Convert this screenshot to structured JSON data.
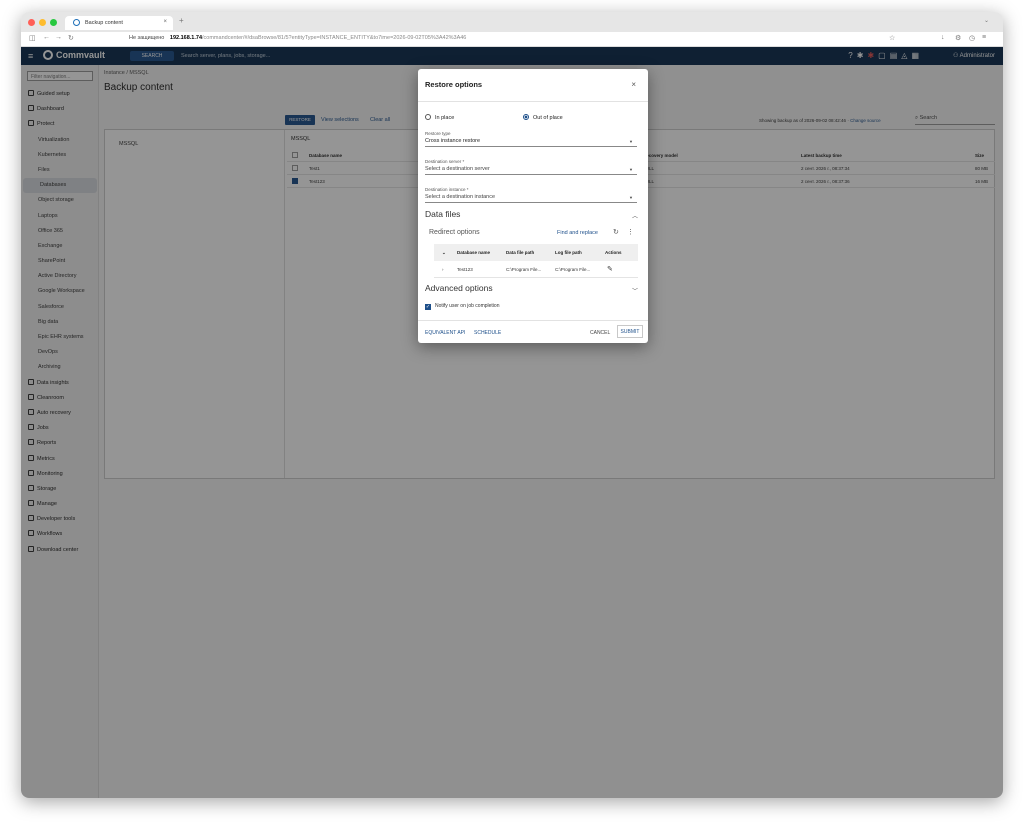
{
  "browser": {
    "tab_title": "Backup content",
    "security_label": "Не защищено",
    "url_host": "192.168.1.74",
    "url_path": "/commandcenter/#/dsaBrowse/81/5?entityType=INSTANCE_ENTITY&to7ime=2026-09-02T05%3A42%3A46"
  },
  "app": {
    "brand": "Commvault",
    "search_button": "SEARCH",
    "search_placeholder": "Search server, plans, jobs, storage...",
    "user": "Administrator"
  },
  "sidebar": {
    "filter_placeholder": "Filter navigation...",
    "items": [
      {
        "label": "Guided setup",
        "type": "top"
      },
      {
        "label": "Dashboard",
        "type": "top"
      },
      {
        "label": "Protect",
        "type": "top"
      },
      {
        "label": "Virtualization",
        "type": "child"
      },
      {
        "label": "Kubernetes",
        "type": "child"
      },
      {
        "label": "Files",
        "type": "child"
      },
      {
        "label": "Databases",
        "type": "child",
        "active": true
      },
      {
        "label": "Object storage",
        "type": "child"
      },
      {
        "label": "Laptops",
        "type": "child"
      },
      {
        "label": "Office 365",
        "type": "child"
      },
      {
        "label": "Exchange",
        "type": "child"
      },
      {
        "label": "SharePoint",
        "type": "child"
      },
      {
        "label": "Active Directory",
        "type": "child"
      },
      {
        "label": "Google Workspace",
        "type": "child"
      },
      {
        "label": "Salesforce",
        "type": "child"
      },
      {
        "label": "Big data",
        "type": "child"
      },
      {
        "label": "Epic EHR systems",
        "type": "child"
      },
      {
        "label": "DevOps",
        "type": "child"
      },
      {
        "label": "Archiving",
        "type": "child"
      },
      {
        "label": "Data insights",
        "type": "top"
      },
      {
        "label": "Cleanroom",
        "type": "top"
      },
      {
        "label": "Auto recovery",
        "type": "top"
      },
      {
        "label": "Jobs",
        "type": "top"
      },
      {
        "label": "Reports",
        "type": "top"
      },
      {
        "label": "Metrics",
        "type": "top"
      },
      {
        "label": "Monitoring",
        "type": "top"
      },
      {
        "label": "Storage",
        "type": "top"
      },
      {
        "label": "Manage",
        "type": "top"
      },
      {
        "label": "Developer tools",
        "type": "top"
      },
      {
        "label": "Workflows",
        "type": "top"
      },
      {
        "label": "Download center",
        "type": "top"
      }
    ]
  },
  "page": {
    "breadcrumb": "Instance / MSSQL",
    "title": "Backup content",
    "toolbar": {
      "restore": "RESTORE",
      "view_selections": "View selections",
      "clear_all": "Clear all",
      "showing": "Showing backup as of 2026-09-02 08:42:46",
      "change_source": "Change source",
      "search": "Search"
    },
    "tree_item": "MSSQL",
    "grid_title": "MSSQL",
    "columns": [
      "Database name",
      "Recovery model",
      "Latest backup time",
      "Size"
    ],
    "rows": [
      {
        "name": "Test1",
        "recovery": "FULL",
        "time": "2 сент. 2026 г., 08:37:34",
        "size": "80 MB",
        "checked": false
      },
      {
        "name": "Test123",
        "recovery": "FULL",
        "time": "2 сент. 2026 г., 08:37:36",
        "size": "16 MB",
        "checked": true
      }
    ]
  },
  "modal": {
    "title": "Restore options",
    "in_place": "In place",
    "out_of_place": "Out of place",
    "restore_type_label": "Restore type",
    "restore_type_value": "Cross instance restore",
    "dest_server_label": "Destination server *",
    "dest_server_placeholder": "Select a destination server",
    "dest_instance_label": "Destination instance *",
    "dest_instance_placeholder": "Select a destination instance",
    "data_files": "Data files",
    "redirect_options": "Redirect options",
    "find_replace": "Find and replace",
    "redirect_columns": [
      "Database name",
      "Data file path",
      "Log file path",
      "Actions"
    ],
    "redirect_row": {
      "name": "Test123",
      "data_path": "C:\\Program File...",
      "log_path": "C:\\Program File..."
    },
    "advanced_options": "Advanced options",
    "notify": "Notify user on job completion",
    "equivalent_api": "EQUIVALENT API",
    "schedule": "SCHEDULE",
    "cancel": "CANCEL",
    "submit": "SUBMIT"
  }
}
